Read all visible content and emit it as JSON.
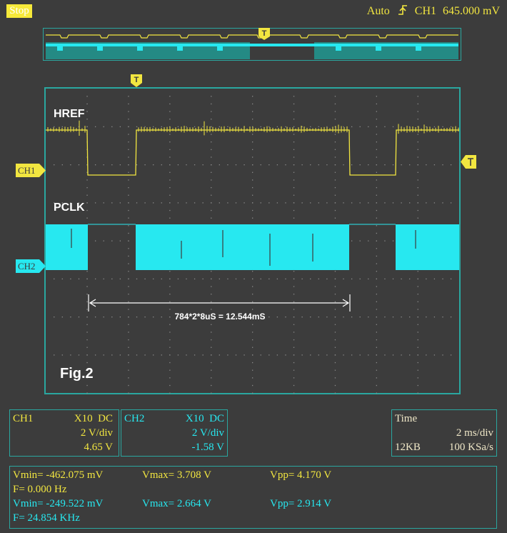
{
  "status": {
    "run_state": "Stop"
  },
  "trigger_readout": {
    "mode": "Auto",
    "source": "CH1",
    "level": "645.000 mV"
  },
  "markers": {
    "trigger": "T",
    "ch1": "CH1",
    "ch2": "CH2"
  },
  "screen": {
    "label_href": "HREF",
    "label_pclk": "PCLK",
    "measurement": "784*2*8uS = 12.544mS",
    "figure": "Fig.2"
  },
  "ch1": {
    "name": "CH1",
    "probe": "X10",
    "coupling": "DC",
    "scale": "2 V/div",
    "offset": "4.65 V"
  },
  "ch2": {
    "name": "CH2",
    "probe": "X10",
    "coupling": "DC",
    "scale": "2 V/div",
    "offset": "-1.58 V"
  },
  "time": {
    "title": "Time",
    "scale": "2 ms/div",
    "memory": "12KB",
    "rate": "100 KSa/s"
  },
  "measure": {
    "ch1": {
      "vmin": "Vmin= -462.075 mV",
      "vmax": "Vmax= 3.708 V",
      "vpp": "Vpp= 4.170 V",
      "freq": "F= 0.000 Hz"
    },
    "ch2": {
      "vmin": "Vmin= -249.522 mV",
      "vmax": "Vmax= 2.664 V",
      "vpp": "Vpp= 2.914 V",
      "freq": "F= 24.854 KHz"
    }
  },
  "colors": {
    "ch1": "#f2e640",
    "ch2": "#27e8f0",
    "frame": "#2aa7a0",
    "background": "#3c3c3c"
  }
}
